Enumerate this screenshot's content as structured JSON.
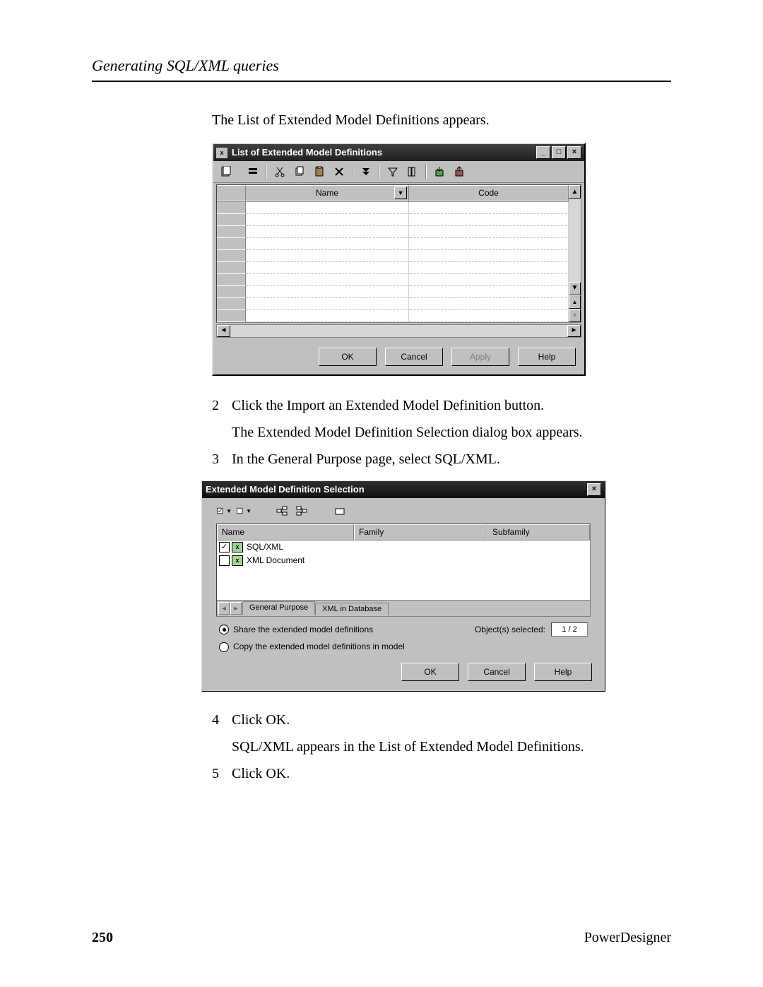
{
  "page": {
    "header": "Generating SQL/XML queries",
    "intro": "The List of Extended Model Definitions appears.",
    "number": "250",
    "product": "PowerDesigner"
  },
  "steps": {
    "s2_text1": "Click the Import an Extended Model Definition button.",
    "s2_text2": "The Extended Model Definition Selection dialog box appears.",
    "s3_text": "In the General Purpose page, select SQL/XML.",
    "s4_text1": "Click OK.",
    "s4_text2": "SQL/XML appears in the List of Extended Model Definitions.",
    "s5_text": "Click OK.",
    "n2": "2",
    "n3": "3",
    "n4": "4",
    "n5": "5"
  },
  "dialog1": {
    "title": "List of Extended Model Definitions",
    "columns": {
      "name": "Name",
      "code": "Code"
    },
    "buttons": {
      "ok": "OK",
      "cancel": "Cancel",
      "apply": "Apply",
      "help": "Help"
    }
  },
  "dialog2": {
    "title": "Extended Model Definition Selection",
    "columns": {
      "name": "Name",
      "family": "Family",
      "subfamily": "Subfamily"
    },
    "rows": [
      {
        "checked": true,
        "label": "SQL/XML"
      },
      {
        "checked": false,
        "label": "XML Document"
      }
    ],
    "tabs": {
      "t1": "General Purpose",
      "t2": "XML in Database"
    },
    "radios": {
      "share": "Share the extended model definitions",
      "copy": "Copy the extended model definitions in model"
    },
    "objsel_label": "Object(s) selected:",
    "objsel_count": "1 / 2",
    "buttons": {
      "ok": "OK",
      "cancel": "Cancel",
      "help": "Help"
    }
  }
}
